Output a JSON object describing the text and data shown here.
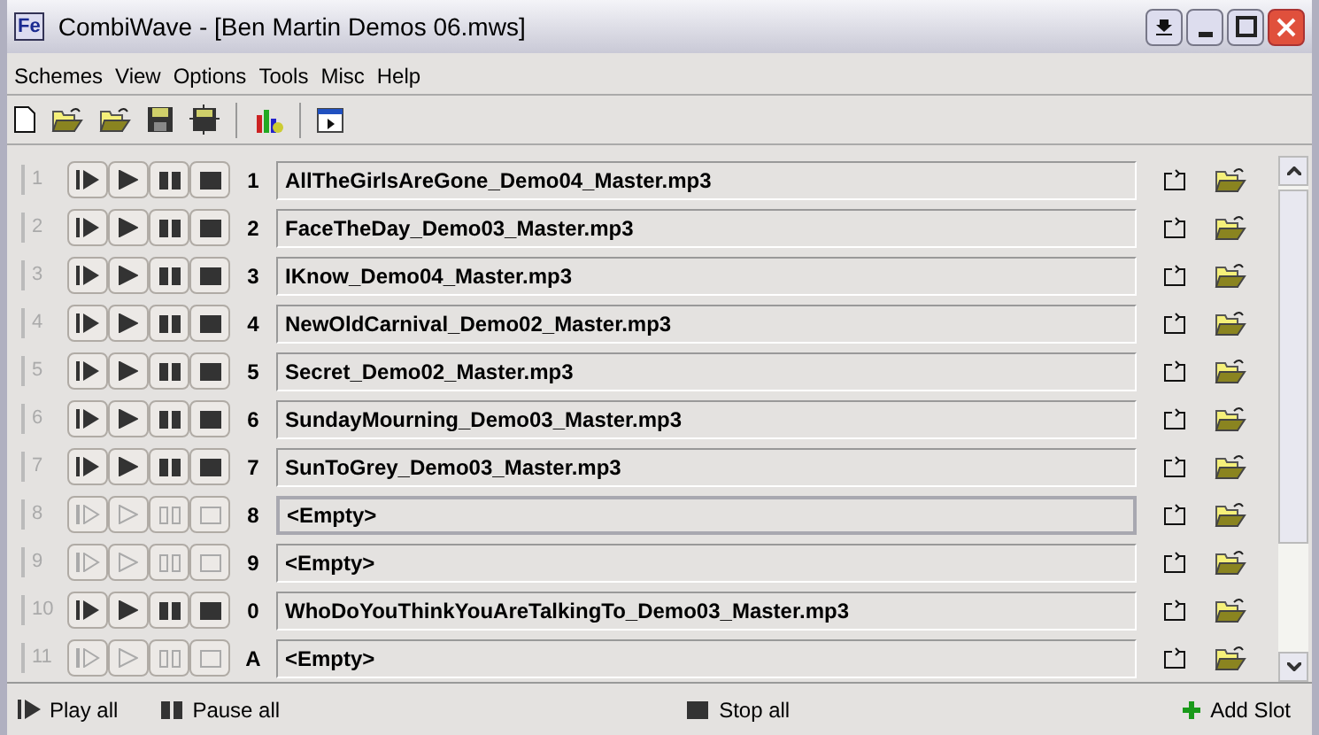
{
  "window": {
    "title": "CombiWave - [Ben Martin Demos 06.mws]",
    "app_icon": "Fe"
  },
  "menu": [
    "Schemes",
    "View",
    "Options",
    "Tools",
    "Misc",
    "Help"
  ],
  "slots": [
    {
      "number": "1",
      "hotkey": "1",
      "file": "AllTheGirlsAreGone_Demo04_Master.mp3",
      "enabled": true,
      "selected": false
    },
    {
      "number": "2",
      "hotkey": "2",
      "file": "FaceTheDay_Demo03_Master.mp3",
      "enabled": true,
      "selected": false
    },
    {
      "number": "3",
      "hotkey": "3",
      "file": "IKnow_Demo04_Master.mp3",
      "enabled": true,
      "selected": false
    },
    {
      "number": "4",
      "hotkey": "4",
      "file": "NewOldCarnival_Demo02_Master.mp3",
      "enabled": true,
      "selected": false
    },
    {
      "number": "5",
      "hotkey": "5",
      "file": "Secret_Demo02_Master.mp3",
      "enabled": true,
      "selected": false
    },
    {
      "number": "6",
      "hotkey": "6",
      "file": "SundayMourning_Demo03_Master.mp3",
      "enabled": true,
      "selected": false
    },
    {
      "number": "7",
      "hotkey": "7",
      "file": "SunToGrey_Demo03_Master.mp3",
      "enabled": true,
      "selected": false
    },
    {
      "number": "8",
      "hotkey": "8",
      "file": "<Empty>",
      "enabled": false,
      "selected": true
    },
    {
      "number": "9",
      "hotkey": "9",
      "file": "<Empty>",
      "enabled": false,
      "selected": false
    },
    {
      "number": "10",
      "hotkey": "0",
      "file": "WhoDoYouThinkYouAreTalkingTo_Demo03_Master.mp3",
      "enabled": true,
      "selected": false
    },
    {
      "number": "11",
      "hotkey": "A",
      "file": "<Empty>",
      "enabled": false,
      "selected": false
    }
  ],
  "bottom_bar": {
    "play_all": "Play all",
    "pause_all": "Pause all",
    "stop_all": "Stop all",
    "add_slot": "Add Slot"
  }
}
